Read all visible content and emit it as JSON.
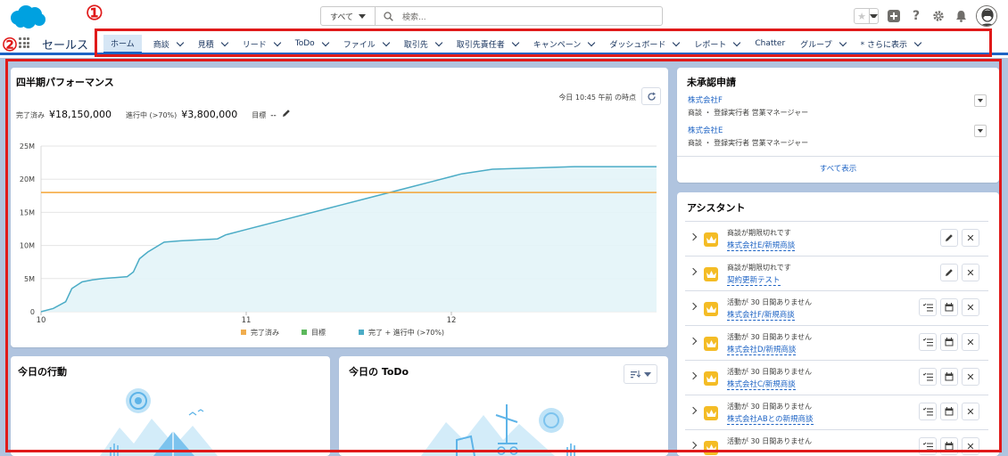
{
  "colors": {
    "brand_blue": "#00a1e0",
    "link_blue": "#1d63c4",
    "highlight_red": "#e01a1a",
    "series_completed": "#f0ad4e",
    "series_goal": "#5cb85c",
    "series_pipeline": "#4bacc6",
    "goal_line": "#f4a436"
  },
  "annotations": {
    "one": "①",
    "two": "②"
  },
  "header": {
    "search": {
      "scope": "すべて",
      "placeholder": "検索..."
    },
    "icons": [
      "favorites-star-icon",
      "add-icon",
      "help-icon",
      "setup-gear-icon",
      "notification-bell-icon",
      "user-avatar"
    ]
  },
  "nav": {
    "app_name": "セールス",
    "items": [
      {
        "label": "ホーム",
        "active": true,
        "chevron": false
      },
      {
        "label": "商談",
        "chevron": true
      },
      {
        "label": "見積",
        "chevron": true
      },
      {
        "label": "リード",
        "chevron": true
      },
      {
        "label": "ToDo",
        "chevron": true
      },
      {
        "label": "ファイル",
        "chevron": true
      },
      {
        "label": "取引先",
        "chevron": true
      },
      {
        "label": "取引先責任者",
        "chevron": true
      },
      {
        "label": "キャンペーン",
        "chevron": true
      },
      {
        "label": "ダッシュボード",
        "chevron": true
      },
      {
        "label": "レポート",
        "chevron": true
      },
      {
        "label": "Chatter",
        "chevron": false
      },
      {
        "label": "グループ",
        "chevron": true
      },
      {
        "label": "* さらに表示",
        "chevron": true
      }
    ]
  },
  "performance": {
    "title": "四半期パフォーマンス",
    "as_of": "今日 10:45 午前 の時点",
    "completed_label": "完了済み",
    "completed_value": "¥18,150,000",
    "pipeline_label": "進行中 (>70%)",
    "pipeline_value": "¥3,800,000",
    "goal_label": "目標",
    "goal_value": "--"
  },
  "chart_data": {
    "type": "area",
    "x_ticks": [
      "10",
      "11",
      "12"
    ],
    "y_ticks": [
      "0",
      "5M",
      "10M",
      "15M",
      "20M",
      "25M"
    ],
    "ylim": [
      0,
      25000000
    ],
    "xlim": [
      0,
      3
    ],
    "legend": [
      "完了済み",
      "目標",
      "完了 + 進行中 (>70%)"
    ],
    "legend_position": "bottom",
    "goal_line_value": 18000000,
    "series": [
      {
        "name": "完了 + 進行中 (>70%)",
        "x": [
          0,
          0.06,
          0.12,
          0.15,
          0.2,
          0.25,
          0.3,
          0.42,
          0.45,
          0.48,
          0.52,
          0.6,
          0.68,
          0.86,
          0.9,
          1.0,
          1.2,
          1.4,
          1.6,
          1.8,
          1.9,
          2.05,
          2.2,
          2.6,
          3.0
        ],
        "values": [
          0,
          500000,
          1500000,
          3500000,
          4500000,
          4800000,
          5000000,
          5300000,
          6000000,
          8000000,
          9000000,
          10500000,
          10700000,
          11000000,
          11600000,
          12400000,
          14000000,
          15600000,
          17200000,
          18800000,
          19600000,
          20800000,
          21500000,
          21900000,
          21900000
        ]
      }
    ]
  },
  "today_events": {
    "title": "今日の行動"
  },
  "today_tasks": {
    "title": "今日の ToDo"
  },
  "pending_approvals": {
    "title": "未承認申請",
    "items": [
      {
        "company": "株式会社F",
        "detail": "商談 ・ 登録実行者 営業マネージャー"
      },
      {
        "company": "株式会社E",
        "detail": "商談 ・ 登録実行者 営業マネージャー"
      }
    ],
    "view_all": "すべて表示"
  },
  "assistant": {
    "title": "アシスタント",
    "items": [
      {
        "message": "商談が期限切れです",
        "link": "株式会社E/新規商談",
        "kind": "overdue"
      },
      {
        "message": "商談が期限切れです",
        "link": "契約更新テスト",
        "kind": "overdue"
      },
      {
        "message": "活動が 30 日間ありません",
        "link": "株式会社F/新規商談",
        "kind": "inactive"
      },
      {
        "message": "活動が 30 日間ありません",
        "link": "株式会社D/新規商談",
        "kind": "inactive"
      },
      {
        "message": "活動が 30 日間ありません",
        "link": "株式会社C/新規商談",
        "kind": "inactive"
      },
      {
        "message": "活動が 30 日間ありません",
        "link": "株式会社ABとの新規商談",
        "kind": "inactive"
      },
      {
        "message": "活動が 30 日間ありません",
        "link": "",
        "kind": "inactive"
      }
    ]
  }
}
